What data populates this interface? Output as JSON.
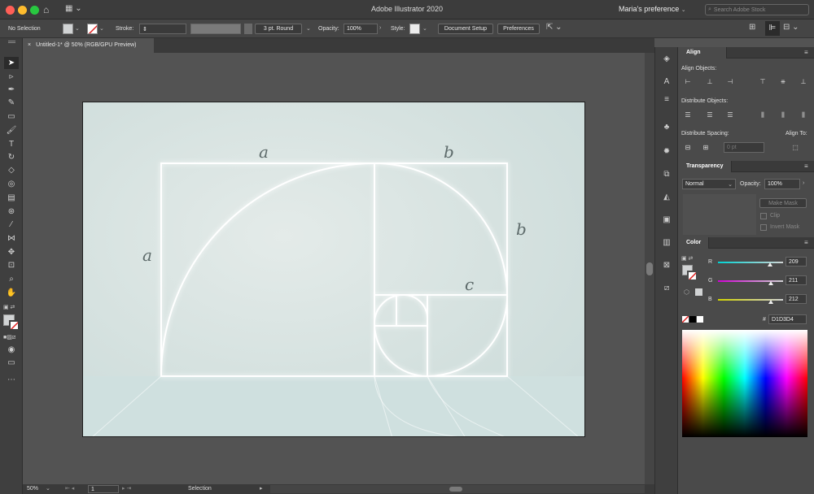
{
  "window": {
    "title": "Adobe Illustrator 2020",
    "workspace": "Maria's preference",
    "search_placeholder": "Search Adobe Stock"
  },
  "control_bar": {
    "selection": "No Selection",
    "stroke_label": "Stroke:",
    "brush": "3 pt. Round",
    "opacity_label": "Opacity:",
    "opacity": "100%",
    "style_label": "Style:",
    "doc_setup": "Document Setup",
    "preferences": "Preferences"
  },
  "document": {
    "tab_title": "Untitled-1* @ 50% (RGB/GPU Preview)"
  },
  "artwork": {
    "label_a_top": "a",
    "label_b_top": "b",
    "label_a_left": "a",
    "label_b_right": "b",
    "label_c": "c"
  },
  "status": {
    "zoom": "50%",
    "page": "1",
    "tool": "Selection"
  },
  "align_panel": {
    "title": "Align",
    "align_objects": "Align Objects:",
    "distribute_objects": "Distribute Objects:",
    "distribute_spacing": "Distribute Spacing:",
    "align_to": "Align To:",
    "spacing_value": "0 pt"
  },
  "transparency_panel": {
    "title": "Transparency",
    "blend_mode": "Normal",
    "opacity_label": "Opacity:",
    "opacity": "100%",
    "make_mask": "Make Mask",
    "clip": "Clip",
    "invert_mask": "Invert Mask"
  },
  "color_panel": {
    "title": "Color",
    "r_label": "R",
    "g_label": "G",
    "b_label": "B",
    "r": 209,
    "g": 211,
    "b": 212,
    "hex_label": "#",
    "hex": "D1D3D4"
  },
  "colors": {
    "fill": "#d1d3d4",
    "r_track": "#2bd4d4",
    "g_track": "#d43bd4",
    "b_track": "#d4d43b"
  }
}
